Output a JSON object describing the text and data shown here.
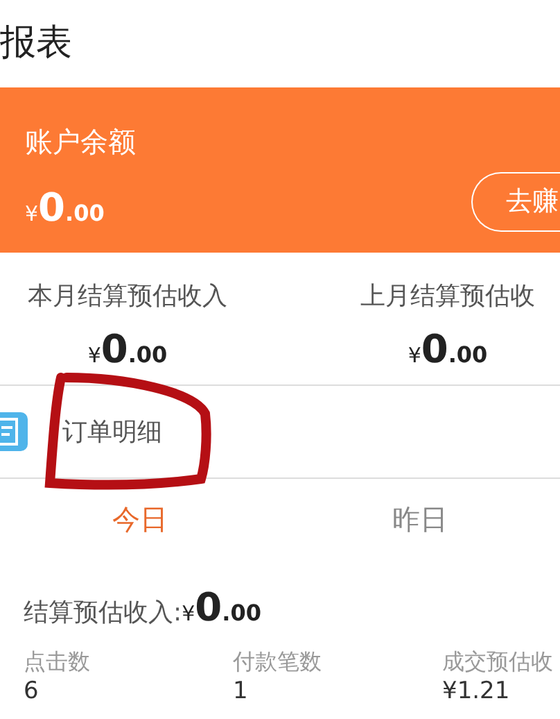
{
  "header": {
    "title": "报表"
  },
  "balance": {
    "label": "账户余额",
    "amount": {
      "currency": "¥",
      "integer": "0",
      "decimal": ".00"
    },
    "button": "去赚"
  },
  "monthly": [
    {
      "label": "本月结算预估收入",
      "amount": {
        "currency": "¥",
        "integer": "0",
        "decimal": ".00"
      }
    },
    {
      "label": "上月结算预估收",
      "amount": {
        "currency": "¥",
        "integer": "0",
        "decimal": ".00"
      }
    }
  ],
  "order_detail": {
    "label": "订单明细"
  },
  "tabs": [
    {
      "label": "今日",
      "selected": true
    },
    {
      "label": "昨日",
      "selected": false
    }
  ],
  "settlement": {
    "label": "结算预估收入:",
    "amount": {
      "currency": "¥",
      "integer": "0",
      "decimal": ".00"
    }
  },
  "stats": [
    {
      "label": "点击数",
      "value": "6"
    },
    {
      "label": "付款笔数",
      "value": "1"
    },
    {
      "label": "成交预估收",
      "value": "¥1.21"
    }
  ]
}
